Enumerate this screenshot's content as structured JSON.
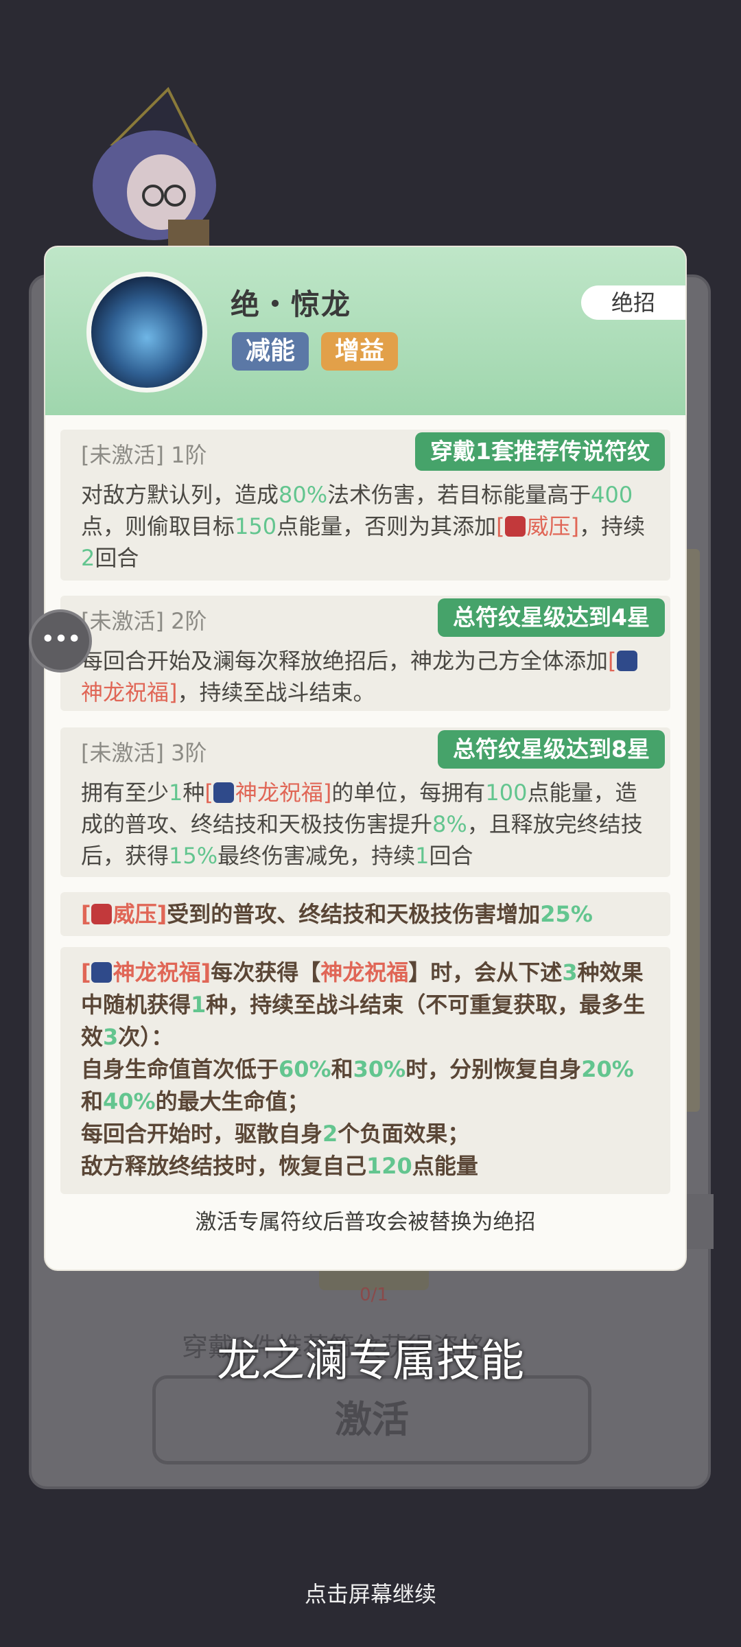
{
  "skill": {
    "title": "绝・惊龙",
    "tags": [
      "减能",
      "增益"
    ],
    "type_label": "绝招",
    "tiers": [
      {
        "status": "[未激活]",
        "stage": "1阶",
        "requirement": "穿戴1套推荐传说符纹",
        "desc_parts": [
          "对敌方默认列，造成",
          "80%",
          "法术伤害，若目标能量高于",
          "400",
          "点，则偷取目标",
          "150",
          "点能量，否则为其添加",
          "[",
          "威压]",
          "，持续",
          "2",
          "回合"
        ]
      },
      {
        "status": "[未激活]",
        "stage": "2阶",
        "requirement": "总符纹星级达到4星",
        "desc_parts": [
          "每回合开始及澜每次释放绝招后，神龙为己方全体添加",
          "[",
          "神龙祝福]",
          "，持续至战斗结束。"
        ]
      },
      {
        "status": "[未激活]",
        "stage": "3阶",
        "requirement": "总符纹星级达到8星",
        "desc_parts": [
          "拥有至少",
          "1",
          "种",
          "[",
          "神龙祝福]",
          "的单位，每拥有",
          "100",
          "点能量，造成的普攻、终结技和天极技伤害提升",
          "8%",
          "，且释放完终结技后，获得",
          "15%",
          "最终伤害减免，持续",
          "1",
          "回合"
        ]
      }
    ],
    "weiya_note": {
      "open": "[",
      "name": "威压]",
      "text": "受到的普攻、终结技和天极技伤害增加",
      "value": "25%"
    },
    "blessing_note": {
      "line1": [
        "[",
        "神龙祝福]",
        "每次获得【",
        "神龙祝福",
        "】时，会从下述",
        "3",
        "种效果中随机获得",
        "1",
        "种，持续至战斗结束（不可重复获取，最多生效",
        "3",
        "次）："
      ],
      "line2": [
        "自身生命值首次低于",
        "60%",
        "和",
        "30%",
        "时，分别恢复自身",
        "20%",
        "和",
        "40%",
        "的最大生命值；"
      ],
      "line3": [
        "每回合开始时，驱散自身",
        "2",
        "个负面效果；"
      ],
      "line4": [
        "敌方释放终结技时，恢复自己",
        "120",
        "点能量"
      ]
    },
    "footer_note": "激活专属符纹后普攻会被替换为绝招"
  },
  "background": {
    "slot_count": "0/1",
    "requirement_text": "穿戴1件推荐符纹获得资格",
    "activate_label": "激活"
  },
  "subtitle": "龙之澜专属技能",
  "continue_hint": "点击屏幕继续",
  "chat_icon": "chat-bubble-icon"
}
